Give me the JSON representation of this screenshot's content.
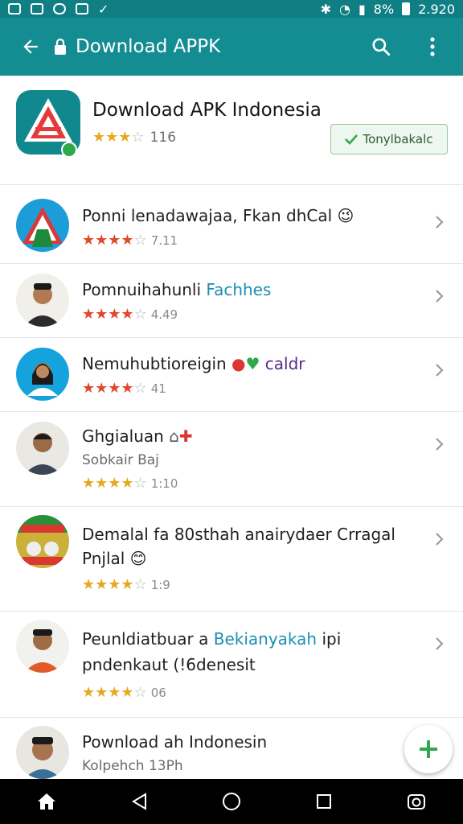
{
  "status_bar": {
    "battery": "8%",
    "time": "2.920"
  },
  "app_bar": {
    "title": "Download APPK"
  },
  "featured": {
    "app_name": "Download APK Indonesia",
    "rating_count": "116",
    "install_label": "Tonylbakalc",
    "stars": 3
  },
  "list": [
    {
      "title": "Ponni lenadawajaa, Fkan dhCal",
      "emoji": "😉",
      "rating_text": "7.11",
      "stars": 4,
      "star_color": "red"
    },
    {
      "title": "Pomnuihahunli",
      "accent": "Fachhes",
      "rating_text": "4.49",
      "stars": 4,
      "star_color": "red"
    },
    {
      "title": "Nemuhubtioreigin",
      "accent": "caldr",
      "rating_text": "41",
      "stars": 4,
      "star_color": "red"
    },
    {
      "title": "Ghgialuan",
      "subtitle": "Sobkair Baj",
      "rating_text": "1:10",
      "stars": 4,
      "star_color": "gold"
    },
    {
      "title": "Demalal fa 80sthah anairydaer Crragal",
      "subtitle": "Pnjlal",
      "rating_text": "1:9",
      "stars": 4,
      "star_color": "gold"
    },
    {
      "title": "Peunldiatbuar a",
      "accent": "Bekianyakah",
      "title_tail": "ipi",
      "subtitle": "pndenkaut (!6denesit",
      "rating_text": "06",
      "stars": 4,
      "star_color": "gold"
    },
    {
      "title": "Pownload ah Indonesin",
      "subtitle": "Kolpehch 13Ph"
    }
  ],
  "colors": {
    "primary": "#148d92",
    "status_bar": "#0f7f84",
    "accent_green": "#2ea84a",
    "star_red": "#e2472b",
    "star_gold": "#e6a81f"
  }
}
